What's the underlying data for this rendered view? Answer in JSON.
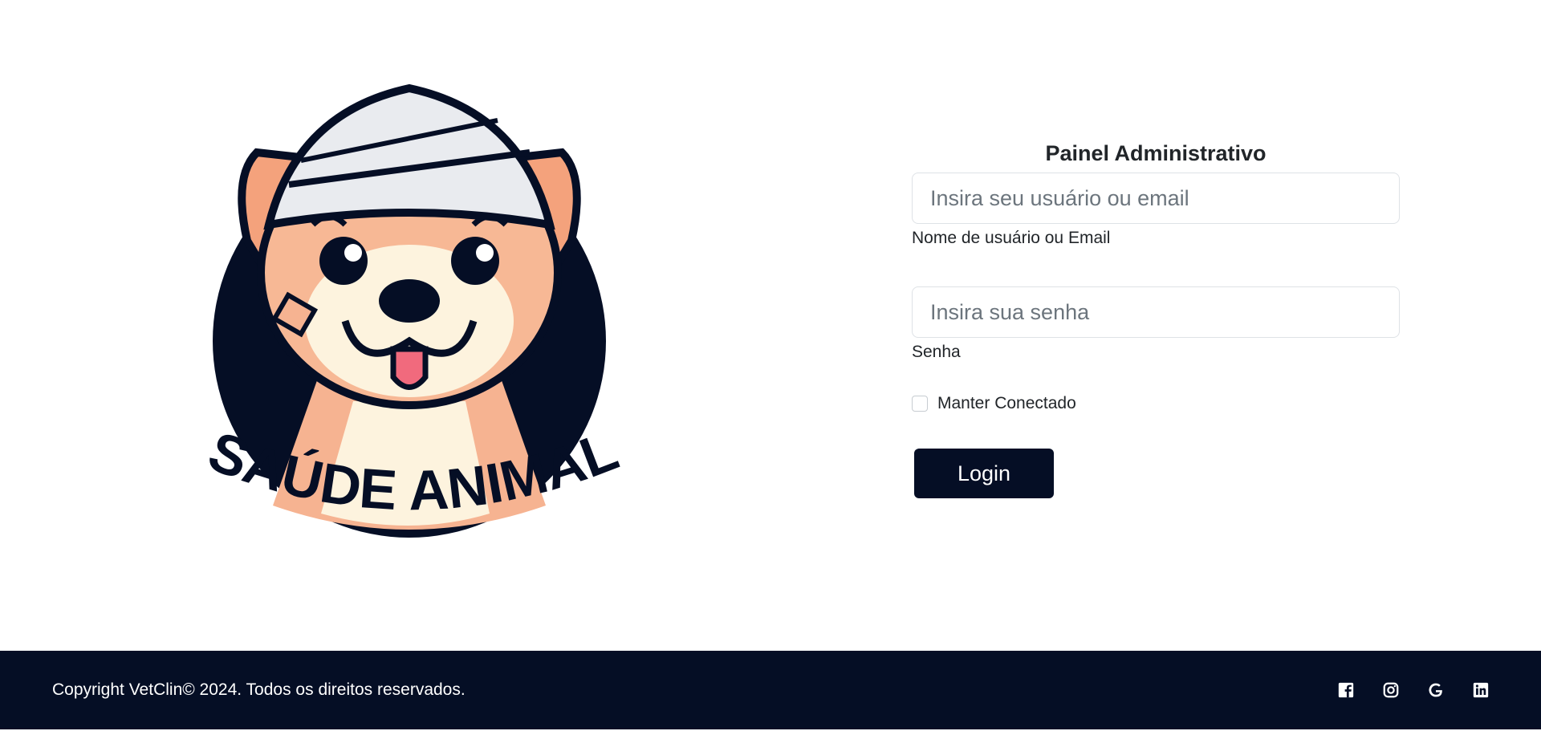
{
  "logo": {
    "text": "SAÚDE ANIMAL"
  },
  "login_panel": {
    "title": "Painel Administrativo",
    "username": {
      "placeholder": "Insira seu usuário ou email",
      "value": "",
      "label": "Nome de usuário ou Email"
    },
    "password": {
      "placeholder": "Insira sua senha",
      "value": "",
      "label": "Senha"
    },
    "remember_label": "Manter Conectado",
    "login_label": "Login"
  },
  "footer": {
    "copyright": "Copyright VetClin© 2024. Todos os direitos reservados.",
    "socials": [
      "facebook-icon",
      "instagram-icon",
      "google-icon",
      "linkedin-icon"
    ]
  },
  "colors": {
    "navy": "#050e25",
    "border": "#dee2e6"
  }
}
